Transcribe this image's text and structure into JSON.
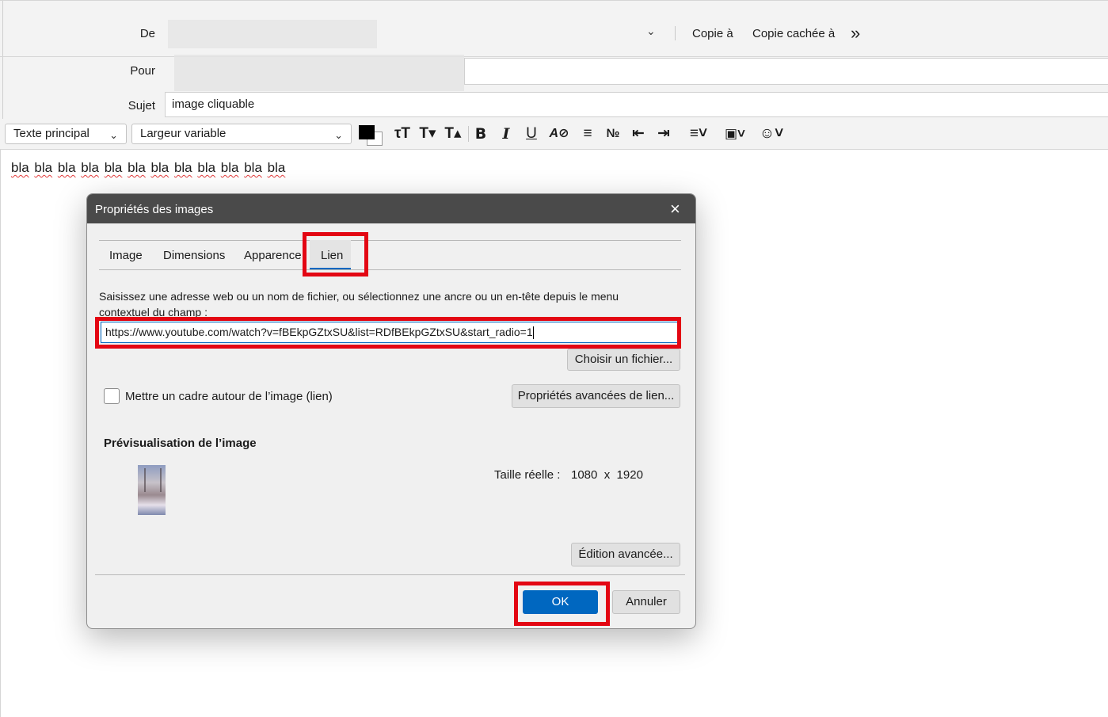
{
  "header": {
    "from_label": "De",
    "to_label": "Pour",
    "subject_label": "Sujet",
    "subject_value": "image cliquable",
    "cc_label": "Copie à",
    "bcc_label": "Copie cachée à",
    "more_icon": "double-chevron-right-icon"
  },
  "toolbar": {
    "paragraph_format": "Texte principal",
    "font": "Largeur variable",
    "text_color": "#000000",
    "icons": [
      "text-smaller-icon",
      "text-reduce-icon",
      "text-larger-icon",
      "bold-icon",
      "italic-icon",
      "underline-icon",
      "clear-format-icon",
      "bullet-list-icon",
      "numbered-list-icon",
      "outdent-icon",
      "indent-icon",
      "align-icon",
      "insert-image-icon",
      "emoji-icon"
    ]
  },
  "body_text": [
    "bla",
    "bla",
    "bla",
    "bla",
    "bla",
    "bla",
    "bla",
    "bla",
    "bla",
    "bla",
    "bla",
    "bla"
  ],
  "dialog": {
    "title": "Propriétés des images",
    "tabs": [
      "Image",
      "Dimensions",
      "Apparence",
      "Lien"
    ],
    "active_tab": "Lien",
    "instruction_line1": "Saisissez une adresse web ou un nom de fichier, ou sélectionnez une ancre ou un en-tête depuis le menu",
    "instruction_line2": "contextuel du champ :",
    "url_value": "https://www.youtube.com/watch?v=fBEkpGZtxSU&list=RDfBEkpGZtxSU&start_radio=1",
    "choose_file_label": "Choisir un fichier...",
    "border_checkbox_label": "Mettre un cadre autour de l’image (lien)",
    "advanced_link_label": "Propriétés avancées de lien...",
    "preview_heading": "Prévisualisation de l’image",
    "real_size_label": "Taille réelle :",
    "real_size_value": "1080  x  1920",
    "advanced_edit_label": "Édition avancée...",
    "ok_label": "OK",
    "cancel_label": "Annuler"
  },
  "colors": {
    "highlight": "#e30613",
    "ok_button": "#0067c0",
    "titlebar": "#4a4a4a"
  }
}
